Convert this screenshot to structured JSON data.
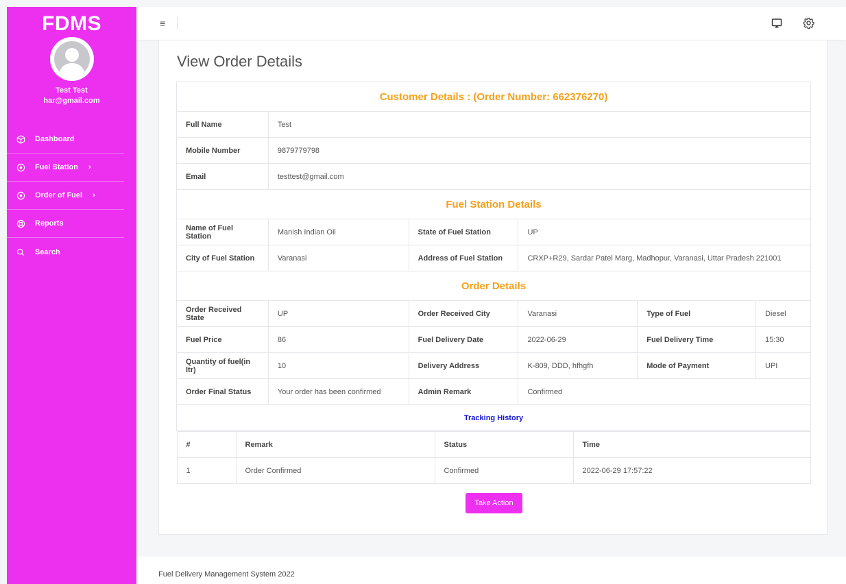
{
  "sidebar": {
    "brand": "FDMS",
    "user_name": "Test Test",
    "user_email": "har@gmail.com",
    "items": [
      {
        "label": "Dashboard",
        "icon": "cube-icon",
        "chevron": ""
      },
      {
        "label": "Fuel Station",
        "icon": "circle-dot-icon",
        "chevron": "›"
      },
      {
        "label": "Order of Fuel",
        "icon": "circle-dot-icon",
        "chevron": "›"
      },
      {
        "label": "Reports",
        "icon": "lifebuoy-icon",
        "chevron": ""
      },
      {
        "label": "Search",
        "icon": "search-icon",
        "chevron": ""
      }
    ]
  },
  "topbar": {
    "menu_icon": "≡"
  },
  "main": {
    "title": "View Order Details",
    "customer_header": "Customer Details : (Order Number: 662376270)",
    "customer": [
      {
        "label": "Full Name",
        "value": "Test"
      },
      {
        "label": "Mobile Number",
        "value": "9879779798"
      },
      {
        "label": "Email",
        "value": "testtest@gmail.com"
      }
    ],
    "station_header": "Fuel Station Details",
    "station": {
      "name_label": "Name of Fuel Station",
      "name_value": "Manish Indian Oil",
      "state_label": "State of Fuel Station",
      "state_value": "UP",
      "city_label": "City of Fuel Station",
      "city_value": "Varanasi",
      "address_label": "Address of Fuel Station",
      "address_value": "CRXP+R29, Sardar Patel Marg, Madhopur, Varanasi, Uttar Pradesh 221001"
    },
    "order_header": "Order Details",
    "order": [
      [
        "Order Received State",
        "UP",
        "Order Received City",
        "Varanasi",
        "Type of Fuel",
        "Diesel"
      ],
      [
        "Fuel Price",
        "86",
        "Fuel Delivery Date",
        "2022-06-29",
        "Fuel Delivery Time",
        "15:30"
      ],
      [
        "Quantity of fuel(in ltr)",
        "10",
        "Delivery Address",
        "K-809, DDD, hfhgfh",
        "Mode of Payment",
        "UPI"
      ],
      [
        "Order Final Status",
        "Your order has been confirmed",
        "Admin Remark",
        "Confirmed"
      ]
    ],
    "tracking_header": "Tracking History",
    "tracking_columns": [
      "#",
      "Remark",
      "Status",
      "Time"
    ],
    "tracking_rows": [
      [
        "1",
        "Order Confirmed",
        "Confirmed",
        "2022-06-29 17:57:22"
      ]
    ],
    "action_label": "Take Action"
  },
  "footer": {
    "text": "Fuel Delivery Management System 2022"
  },
  "colors": {
    "accent": "#ed2ff0",
    "section_heading": "#f5a11a",
    "tracking_heading": "#1414d6"
  }
}
